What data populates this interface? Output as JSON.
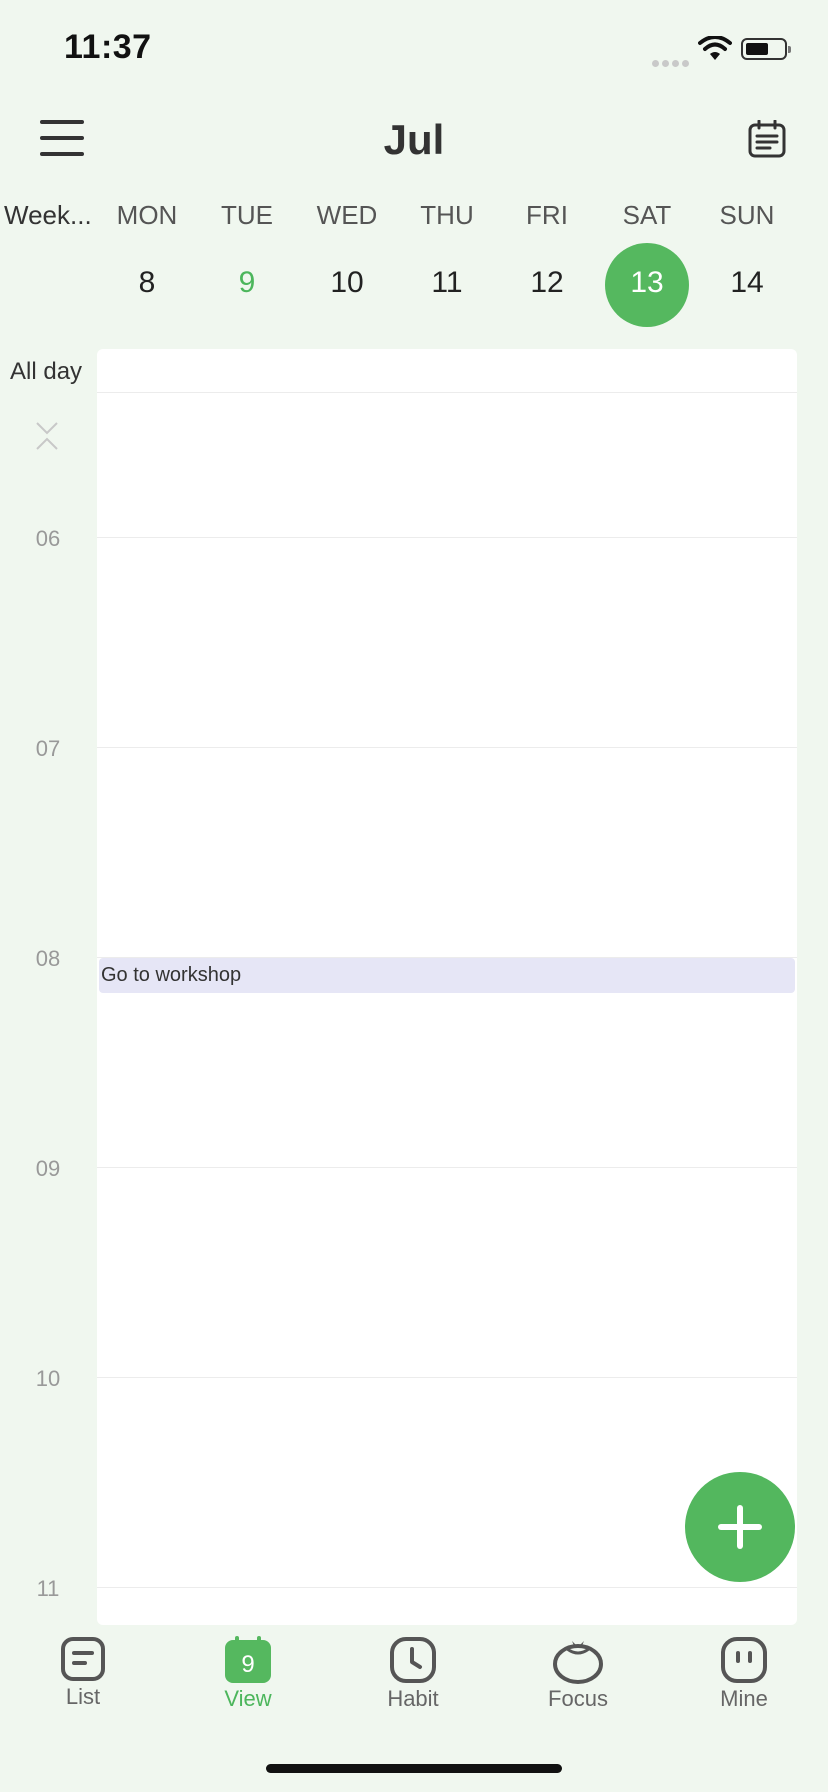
{
  "status_bar": {
    "time": "11:37"
  },
  "header": {
    "month": "Jul"
  },
  "week_row": {
    "week_label": "Week...",
    "days": [
      {
        "name": "MON",
        "num": "8"
      },
      {
        "name": "TUE",
        "num": "9"
      },
      {
        "name": "WED",
        "num": "10"
      },
      {
        "name": "THU",
        "num": "11"
      },
      {
        "name": "FRI",
        "num": "12"
      },
      {
        "name": "SAT",
        "num": "13"
      },
      {
        "name": "SUN",
        "num": "14"
      }
    ],
    "today": "9",
    "selected": "13"
  },
  "calendar": {
    "all_day_label": "All day",
    "hours": [
      "06",
      "07",
      "08",
      "09",
      "10",
      "11"
    ],
    "event": {
      "title": "Go to workshop"
    }
  },
  "tabs": [
    {
      "label": "List",
      "icon": "list-icon"
    },
    {
      "label": "View",
      "icon": "calendar-view-icon",
      "badge": "9"
    },
    {
      "label": "Habit",
      "icon": "clock-icon"
    },
    {
      "label": "Focus",
      "icon": "tomato-icon"
    },
    {
      "label": "Mine",
      "icon": "profile-face-icon"
    }
  ],
  "colors": {
    "accent": "#55b85f",
    "background": "#f0f7ef",
    "event": "#e6e6f6"
  }
}
